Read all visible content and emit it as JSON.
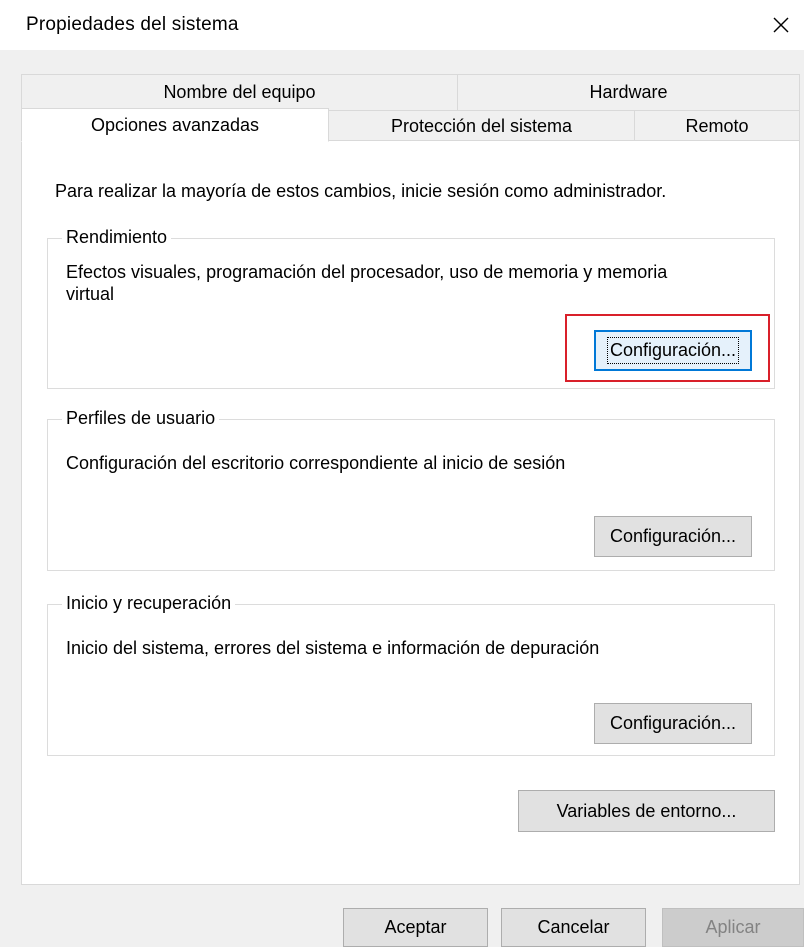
{
  "window": {
    "title": "Propiedades del sistema"
  },
  "tabs": {
    "row1": [
      {
        "label": "Nombre del equipo"
      },
      {
        "label": "Hardware"
      }
    ],
    "row2": [
      {
        "label": "Opciones avanzadas",
        "active": true
      },
      {
        "label": "Protección del sistema"
      },
      {
        "label": "Remoto"
      }
    ]
  },
  "panel": {
    "intro": "Para realizar la mayoría de estos cambios, inicie sesión como administrador.",
    "groups": [
      {
        "title": "Rendimiento",
        "description": "Efectos visuales, programación del procesador, uso de memoria y memoria virtual",
        "button_label": "Configuración..."
      },
      {
        "title": "Perfiles de usuario",
        "description": "Configuración del escritorio correspondiente al inicio de sesión",
        "button_label": "Configuración..."
      },
      {
        "title": "Inicio y recuperación",
        "description": "Inicio del sistema, errores del sistema e información de depuración",
        "button_label": "Configuración..."
      }
    ],
    "env_button_label": "Variables de entorno..."
  },
  "footer": {
    "ok_label": "Aceptar",
    "cancel_label": "Cancelar",
    "apply_label": "Aplicar"
  },
  "colors": {
    "highlight": "#d9202a",
    "focus": "#0078d7"
  }
}
